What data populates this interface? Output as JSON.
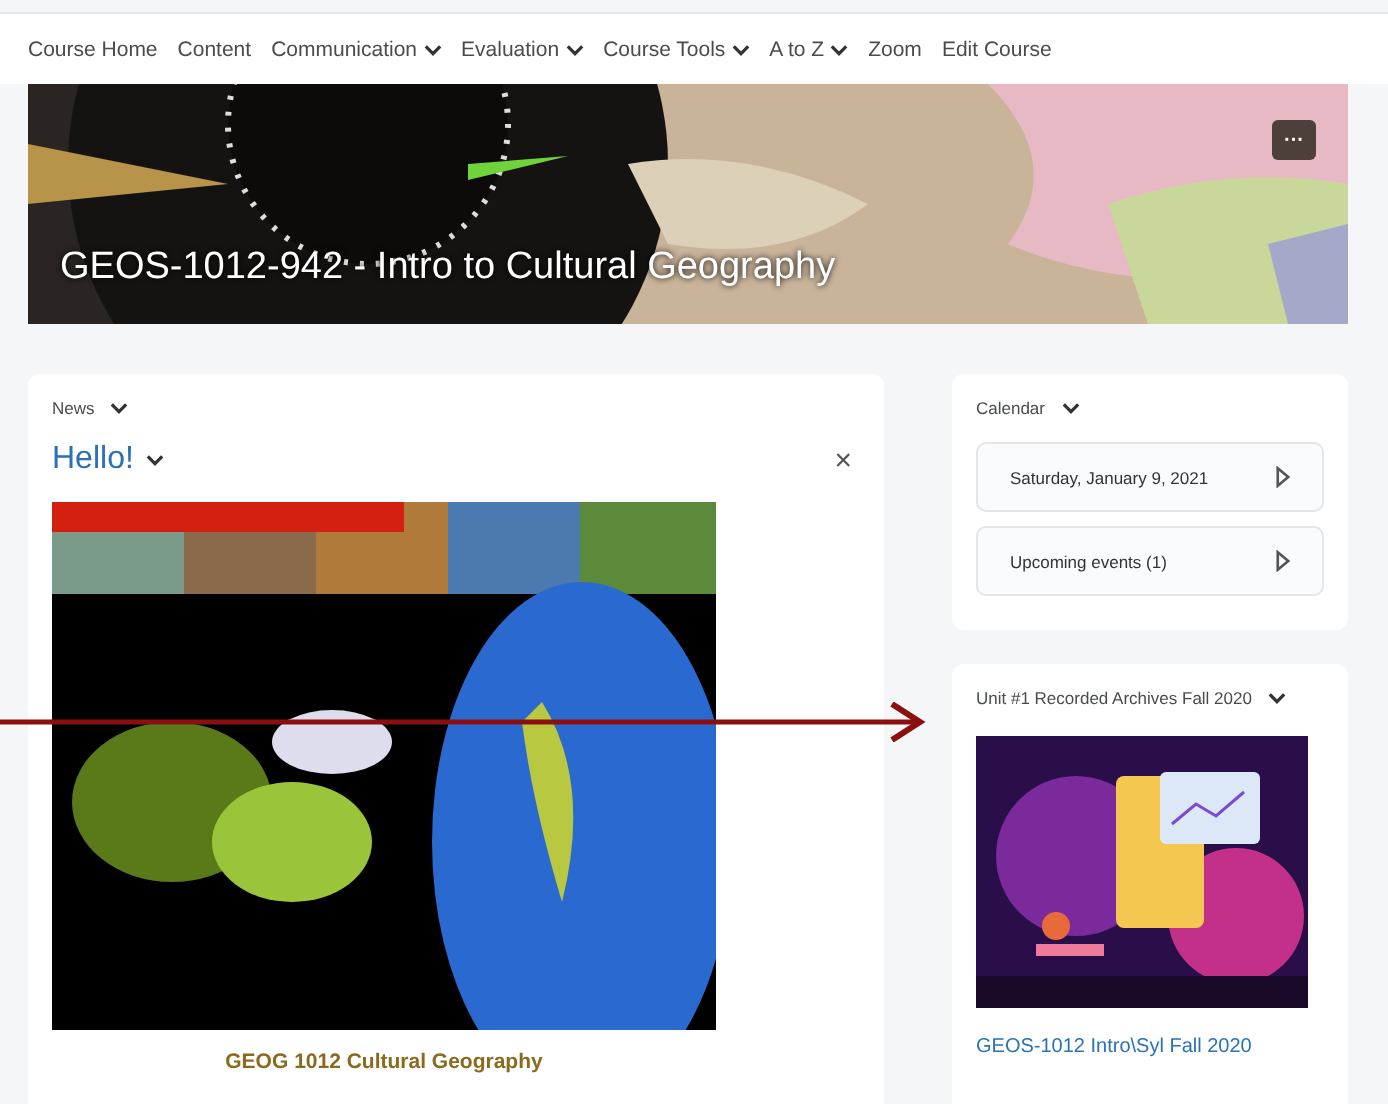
{
  "nav": [
    {
      "label": "Course Home",
      "dropdown": false
    },
    {
      "label": "Content",
      "dropdown": false
    },
    {
      "label": "Communication",
      "dropdown": true
    },
    {
      "label": "Evaluation",
      "dropdown": true
    },
    {
      "label": "Course Tools",
      "dropdown": true
    },
    {
      "label": "A to Z",
      "dropdown": true
    },
    {
      "label": "Zoom",
      "dropdown": false
    },
    {
      "label": "Edit Course",
      "dropdown": false
    }
  ],
  "banner": {
    "title": "GEOS-1012-942 - Intro to Cultural Geography",
    "menu_button": "···"
  },
  "news": {
    "widget_title": "News",
    "item_title": "Hello!",
    "close": "×",
    "caption": "GEOG 1012  Cultural Geography"
  },
  "calendar": {
    "widget_title": "Calendar",
    "entries": [
      "Saturday, January 9, 2021",
      "Upcoming events (1)"
    ]
  },
  "unit": {
    "widget_title": "Unit #1 Recorded Archives Fall 2020",
    "link": "GEOS-1012 Intro\\Syl Fall 2020"
  }
}
